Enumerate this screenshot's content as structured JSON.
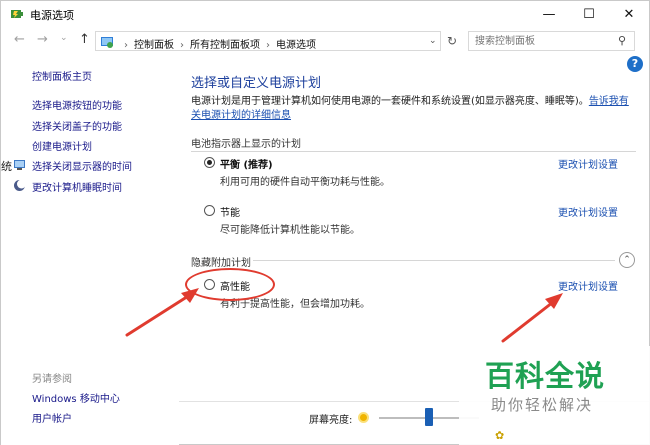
{
  "window": {
    "title": "电源选项",
    "controls": {
      "minimize": "—",
      "maximize": "☐",
      "close": "✕"
    }
  },
  "nav": {
    "back_icon": "←",
    "forward_icon": "→",
    "dropdown_icon": "⌄",
    "up_icon": "↑",
    "breadcrumbs": [
      "控制面板",
      "所有控制面板项",
      "电源选项"
    ],
    "breadcrumb_sep": "›",
    "refresh_icon": "↻",
    "search_placeholder": "搜索控制面板",
    "search_icon": "⚲"
  },
  "sidebar": {
    "home": "控制面板主页",
    "items": [
      {
        "label": "选择电源按钮的功能",
        "icon": null
      },
      {
        "label": "选择关闭盖子的功能",
        "icon": null
      },
      {
        "label": "创建电源计划",
        "icon": null
      },
      {
        "label": "选择关闭显示器的时间",
        "icon": "display-shield-icon"
      },
      {
        "label": "更改计算机睡眠时间",
        "icon": "moon-icon"
      }
    ],
    "see_also_title": "另请参阅",
    "see_also": [
      "Windows 移动中心",
      "用户帐户"
    ],
    "edge_char": "统"
  },
  "main": {
    "help_icon": "?",
    "title": "选择或自定义电源计划",
    "description": "电源计划是用于管理计算机如何使用电源的一套硬件和系统设置(如显示器亮度、睡眠等)。",
    "description_link": "告诉我有关电源计划的详细信息",
    "battery_section": "电池指示器上显示的计划",
    "hidden_section": "隐藏附加计划",
    "collapse_icon": "⌃",
    "change_link": "更改计划设置",
    "plans": [
      {
        "name": "平衡 (推荐)",
        "desc": "利用可用的硬件自动平衡功耗与性能。",
        "selected": true
      },
      {
        "name": "节能",
        "desc": "尽可能降低计算机性能以节能。",
        "selected": false
      },
      {
        "name": "高性能",
        "desc": "有利于提高性能，但会增加功耗。",
        "selected": false
      }
    ]
  },
  "brightness": {
    "label": "屏幕亮度:",
    "level": 0.5
  },
  "watermark": {
    "big": "百科全说",
    "small": "助你轻松解决"
  },
  "accent_color": "#e03b2f"
}
